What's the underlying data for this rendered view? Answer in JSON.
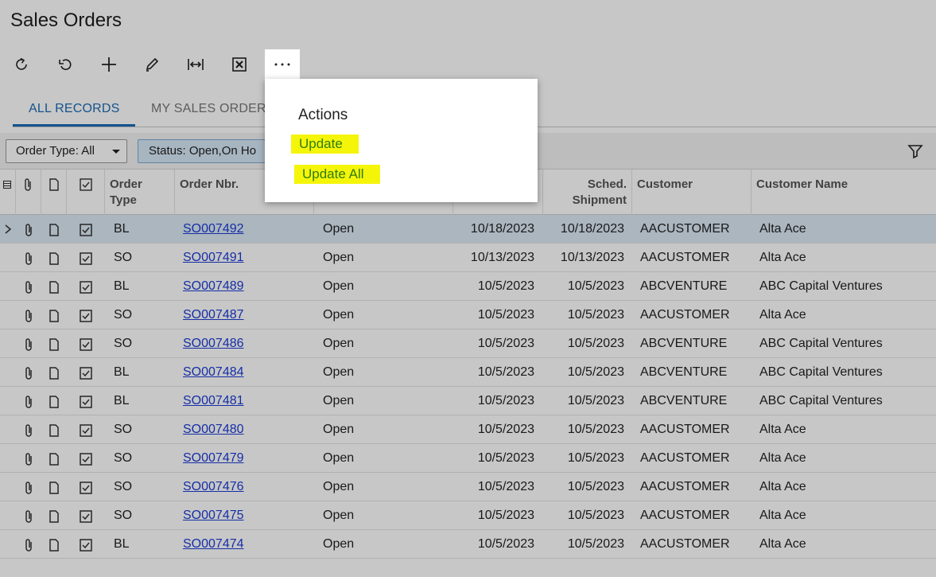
{
  "page": {
    "title": "Sales Orders"
  },
  "toolbar": {
    "buttons": [
      {
        "icon": "refresh-icon"
      },
      {
        "icon": "undo-icon"
      },
      {
        "icon": "add-icon"
      },
      {
        "icon": "edit-icon"
      },
      {
        "icon": "fit-columns-icon"
      },
      {
        "icon": "excel-export-icon"
      },
      {
        "icon": "more-icon"
      }
    ]
  },
  "tabs": {
    "all_records": "ALL RECORDS",
    "my_sales_orders": "MY SALES ORDER"
  },
  "filters": {
    "order_type": "Order Type: All",
    "status": "Status: Open,On Ho"
  },
  "columns": {
    "order_type_1": "Order",
    "order_type_2": "Type",
    "order_nbr": "Order Nbr.",
    "sched_1": "Sched.",
    "sched_2": "Shipment",
    "customer": "Customer",
    "customer_name": "Customer Name"
  },
  "rows": [
    {
      "type": "BL",
      "nbr": "SO007492",
      "status": "Open",
      "date": "10/18/2023",
      "sched": "10/18/2023",
      "customer": "AACUSTOMER",
      "name": "Alta Ace"
    },
    {
      "type": "SO",
      "nbr": "SO007491",
      "status": "Open",
      "date": "10/13/2023",
      "sched": "10/13/2023",
      "customer": "AACUSTOMER",
      "name": "Alta Ace"
    },
    {
      "type": "BL",
      "nbr": "SO007489",
      "status": "Open",
      "date": "10/5/2023",
      "sched": "10/5/2023",
      "customer": "ABCVENTURE",
      "name": "ABC Capital Ventures"
    },
    {
      "type": "SO",
      "nbr": "SO007487",
      "status": "Open",
      "date": "10/5/2023",
      "sched": "10/5/2023",
      "customer": "AACUSTOMER",
      "name": "Alta Ace"
    },
    {
      "type": "SO",
      "nbr": "SO007486",
      "status": "Open",
      "date": "10/5/2023",
      "sched": "10/5/2023",
      "customer": "ABCVENTURE",
      "name": "ABC Capital Ventures"
    },
    {
      "type": "BL",
      "nbr": "SO007484",
      "status": "Open",
      "date": "10/5/2023",
      "sched": "10/5/2023",
      "customer": "ABCVENTURE",
      "name": "ABC Capital Ventures"
    },
    {
      "type": "BL",
      "nbr": "SO007481",
      "status": "Open",
      "date": "10/5/2023",
      "sched": "10/5/2023",
      "customer": "ABCVENTURE",
      "name": "ABC Capital Ventures"
    },
    {
      "type": "SO",
      "nbr": "SO007480",
      "status": "Open",
      "date": "10/5/2023",
      "sched": "10/5/2023",
      "customer": "AACUSTOMER",
      "name": "Alta Ace"
    },
    {
      "type": "SO",
      "nbr": "SO007479",
      "status": "Open",
      "date": "10/5/2023",
      "sched": "10/5/2023",
      "customer": "AACUSTOMER",
      "name": "Alta Ace"
    },
    {
      "type": "SO",
      "nbr": "SO007476",
      "status": "Open",
      "date": "10/5/2023",
      "sched": "10/5/2023",
      "customer": "AACUSTOMER",
      "name": "Alta Ace"
    },
    {
      "type": "SO",
      "nbr": "SO007475",
      "status": "Open",
      "date": "10/5/2023",
      "sched": "10/5/2023",
      "customer": "AACUSTOMER",
      "name": "Alta Ace"
    },
    {
      "type": "BL",
      "nbr": "SO007474",
      "status": "Open",
      "date": "10/5/2023",
      "sched": "10/5/2023",
      "customer": "AACUSTOMER",
      "name": "Alta Ace"
    }
  ],
  "actions_menu": {
    "title": "Actions",
    "items": [
      "Update",
      "Update All"
    ]
  },
  "colors": {
    "accent": "#1a6bb5",
    "link": "#1b3bd6",
    "highlight": "#f5f50a",
    "highlight_text": "#2e7d0a"
  }
}
